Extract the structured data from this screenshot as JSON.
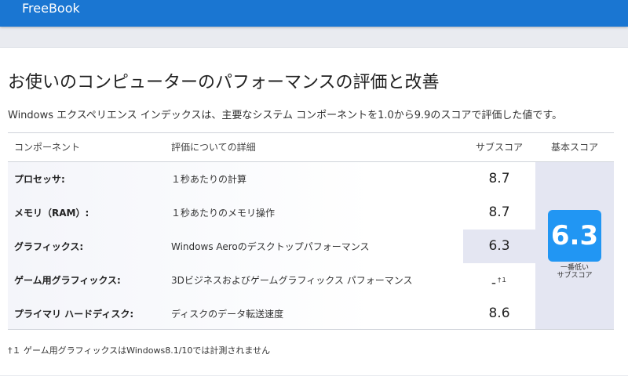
{
  "app": {
    "title": "FreeBook"
  },
  "page": {
    "title": "お使いのコンピューターのパフォーマンスの評価と改善",
    "subtitle": "Windows エクスペリエンス インデックスは、主要なシステム コンポーネントを1.0から9.9のスコアで評価した値です。"
  },
  "table": {
    "headers": {
      "component": "コンポーネント",
      "detail": "評価についての詳細",
      "subscore": "サブスコア",
      "basescore": "基本スコア"
    },
    "rows": [
      {
        "component": "プロセッサ:",
        "detail": "１秒あたりの計算",
        "score": "8.7",
        "mark": ""
      },
      {
        "component": "メモリ（RAM）:",
        "detail": "１秒あたりのメモリ操作",
        "score": "8.7",
        "mark": ""
      },
      {
        "component": "グラフィックス:",
        "detail": "Windows Aeroのデスクトップパフォーマンス",
        "score": "6.3",
        "mark": ""
      },
      {
        "component": "ゲーム用グラフィックス:",
        "detail": "3Dビジネスおよびゲームグラフィックス パフォーマンス",
        "score": "-",
        "mark": "†１"
      },
      {
        "component": "プライマリ ハードディスク:",
        "detail": "ディスクのデータ転送速度",
        "score": "8.6",
        "mark": ""
      }
    ],
    "lowest_row_index": 2,
    "base_score": "6.3",
    "base_caption_line1": "一番低い",
    "base_caption_line2": "サブスコア"
  },
  "footnote": "†１ ゲーム用グラフィックスはWindows8.1/10では計測されません",
  "colors": {
    "header_bar": "#1a76d2",
    "base_score_box": "#2196f3",
    "highlight": "#e4e6f2"
  }
}
